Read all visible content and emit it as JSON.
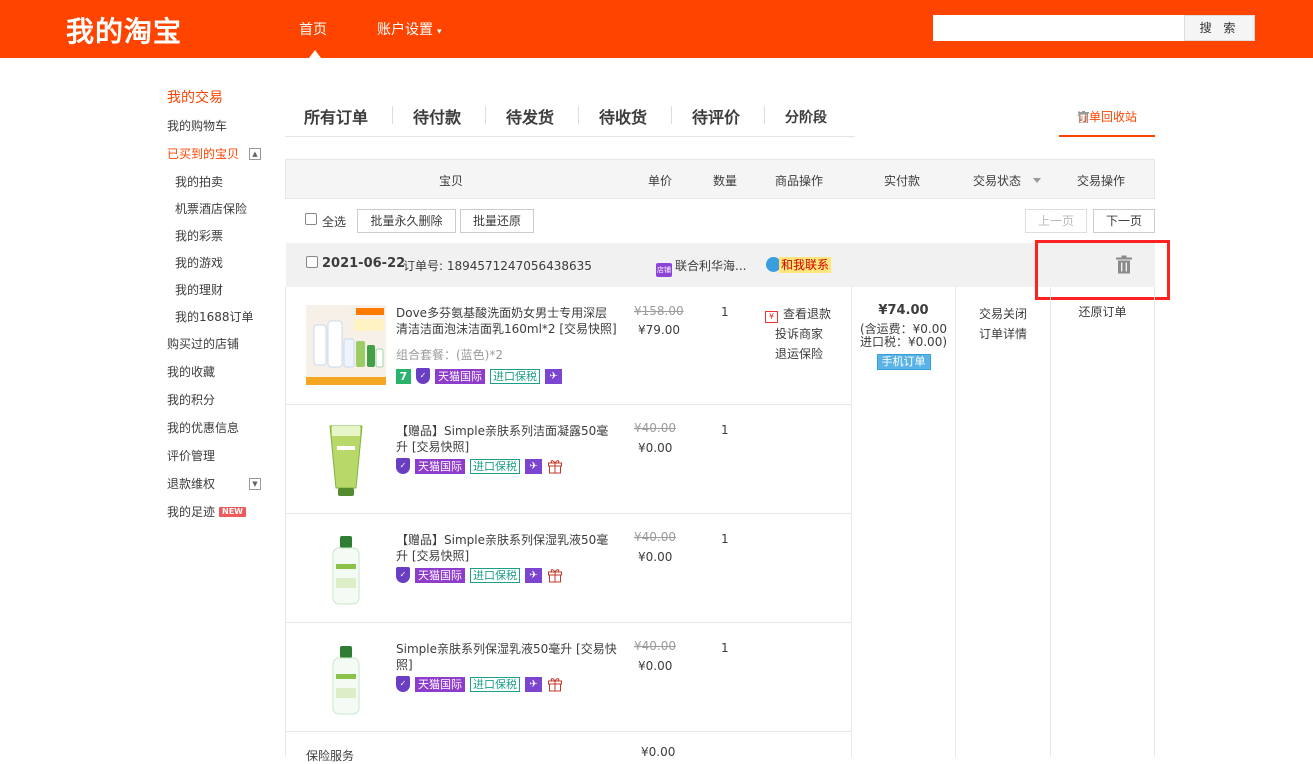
{
  "header": {
    "logo": "我的淘宝",
    "nav_home": "首页",
    "nav_account": "账户设置",
    "nav_account_caret": "▾",
    "search_placeholder": "",
    "search_button": "搜 索"
  },
  "sidebar": {
    "heading": "我的交易",
    "items": [
      {
        "label": "我的购物车"
      },
      {
        "label": "已买到的宝贝",
        "toggle": "▲"
      },
      {
        "label": "我的拍卖"
      },
      {
        "label": "机票酒店保险"
      },
      {
        "label": "我的彩票"
      },
      {
        "label": "我的游戏"
      },
      {
        "label": "我的理财"
      },
      {
        "label": "我的1688订单"
      },
      {
        "label": "购买过的店铺"
      },
      {
        "label": "我的收藏"
      },
      {
        "label": "我的积分"
      },
      {
        "label": "我的优惠信息"
      },
      {
        "label": "评价管理"
      },
      {
        "label": "退款维权",
        "toggle": "▼"
      },
      {
        "label": "我的足迹",
        "badge": "NEW"
      }
    ]
  },
  "tabs": [
    "所有订单",
    "待付款",
    "待发货",
    "待收货",
    "待评价",
    "分阶段"
  ],
  "recycle_bin": "订单回收站",
  "table_header": {
    "item": "宝贝",
    "unit_price": "单价",
    "quantity": "数量",
    "item_ops": "商品操作",
    "paid": "实付款",
    "status": "交易状态",
    "action": "交易操作"
  },
  "batch": {
    "select_all": "全选",
    "delete_forever": "批量永久删除",
    "restore": "批量还原",
    "prev": "上一页",
    "next": "下一页"
  },
  "order": {
    "date": "2021-06-22",
    "order_no_label": "订单号: 1894571247056438635",
    "shop_icon": "店铺",
    "shop": "联合利华海...",
    "contact": "和我联系",
    "items": [
      {
        "title": "Dove多芬氨基酸洗面奶女男士专用深层清洁洁面泡沫洁面乳160ml*2 [交易快照]",
        "spec": "组合套餐：(蓝色)*2",
        "old_price": "¥158.00",
        "price": "¥79.00",
        "qty": "1",
        "badge_seven": "7",
        "badge_tmall": "天猫国际",
        "badge_bonded": "进口保税"
      },
      {
        "title": "【赠品】Simple亲肤系列洁面凝露50毫升 [交易快照]",
        "old_price": "¥40.00",
        "price": "¥0.00",
        "qty": "1",
        "badge_tmall": "天猫国际",
        "badge_bonded": "进口保税"
      },
      {
        "title": "【赠品】Simple亲肤系列保湿乳液50毫升 [交易快照]",
        "old_price": "¥40.00",
        "price": "¥0.00",
        "qty": "1",
        "badge_tmall": "天猫国际",
        "badge_bonded": "进口保税"
      },
      {
        "title": "Simple亲肤系列保湿乳液50毫升 [交易快照]",
        "old_price": "¥40.00",
        "price": "¥0.00",
        "qty": "1",
        "badge_tmall": "天猫国际",
        "badge_bonded": "进口保税"
      }
    ],
    "extra_row_label": "保险服务",
    "extra_row_price": "¥0.00",
    "ops": {
      "refund_icon": "¥",
      "refund": "查看退款",
      "complain": "投诉商家",
      "insurance": "退运保险"
    },
    "payment": {
      "amount": "¥74.00",
      "shipping": "(含运费：¥0.00",
      "tax": "进口税：¥0.00)",
      "mobile": "手机订单"
    },
    "status": {
      "closed": "交易关闭",
      "detail": "订单详情"
    },
    "action": "还原订单"
  },
  "colors": {
    "brand": "#ff4400",
    "highlight": "#ff2222"
  }
}
